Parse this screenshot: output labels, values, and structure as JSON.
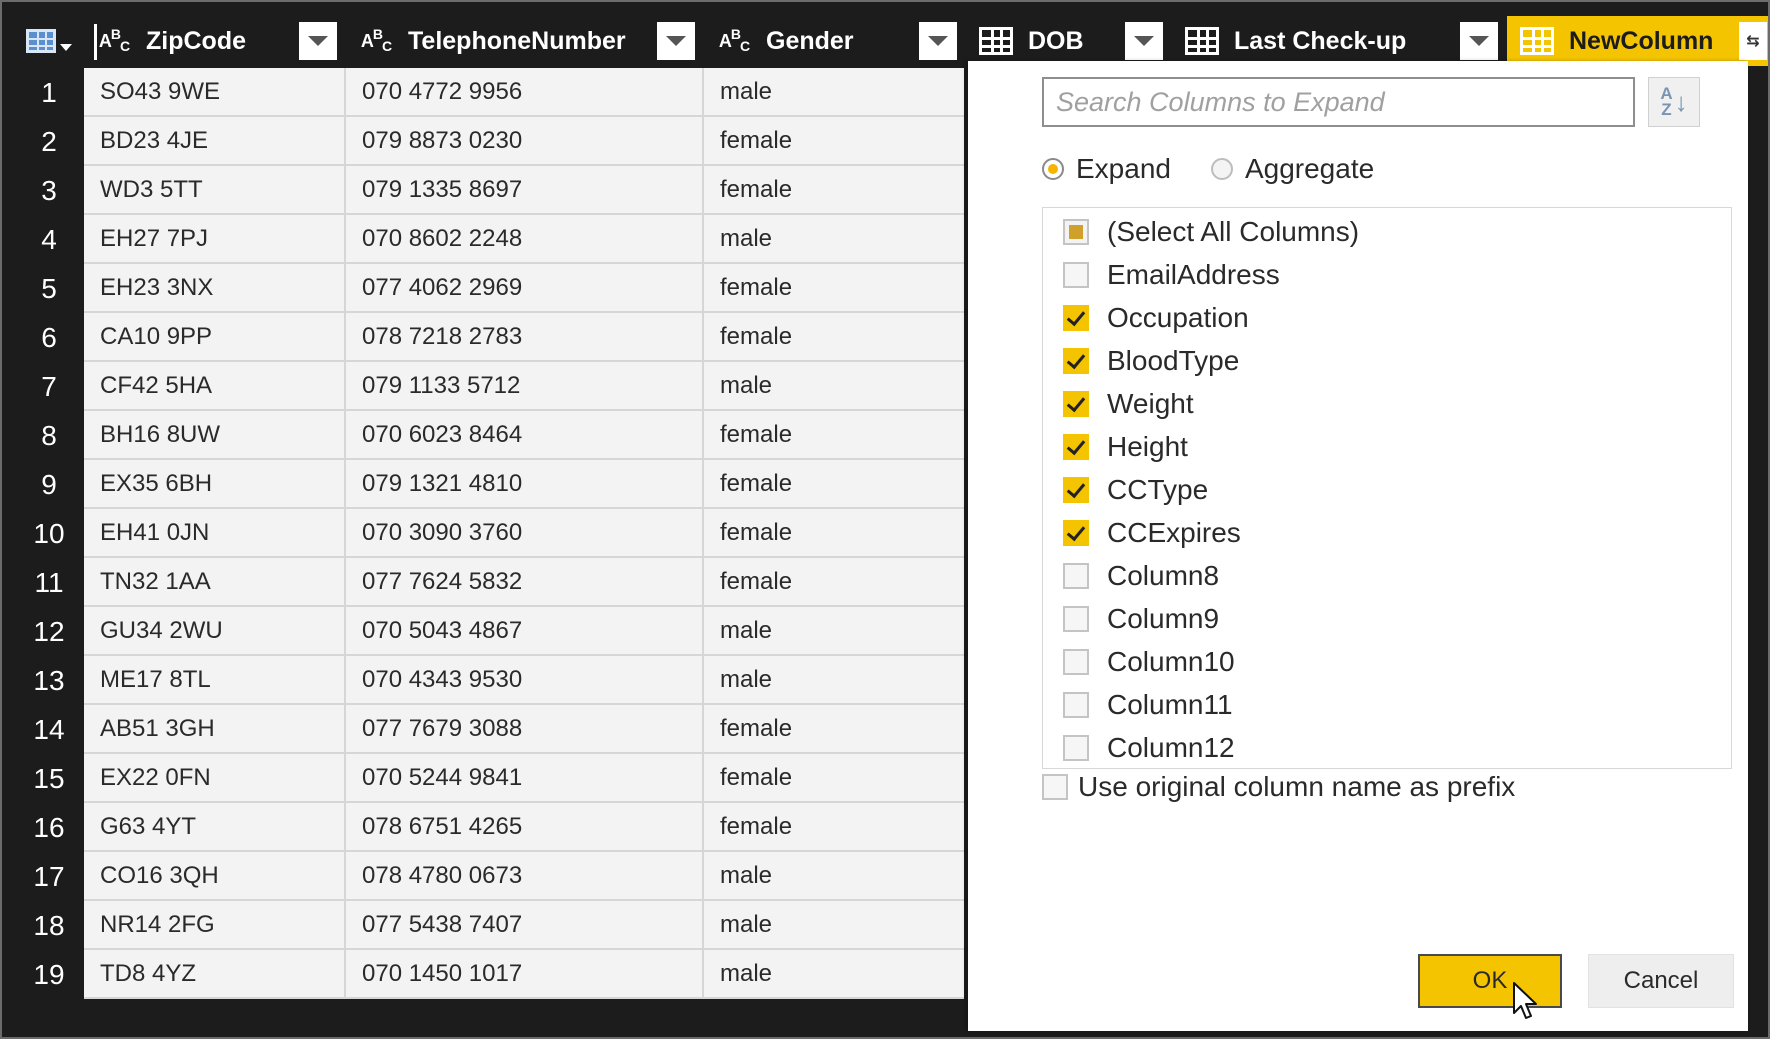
{
  "header": {
    "columns": [
      {
        "type": "ABC",
        "label": "ZipCode"
      },
      {
        "type": "ABC",
        "label": "TelephoneNumber"
      },
      {
        "type": "ABC",
        "label": "Gender"
      },
      {
        "type": "table",
        "label": "DOB"
      },
      {
        "type": "table",
        "label": "Last Check-up"
      },
      {
        "type": "table",
        "label": "NewColumn"
      }
    ],
    "expand_glyph": "⇆"
  },
  "rows": [
    {
      "n": "1",
      "zip": "SO43 9WE",
      "tel": "070 4772 9956",
      "gender": "male"
    },
    {
      "n": "2",
      "zip": "BD23 4JE",
      "tel": "079 8873 0230",
      "gender": "female"
    },
    {
      "n": "3",
      "zip": "WD3 5TT",
      "tel": "079 1335 8697",
      "gender": "female"
    },
    {
      "n": "4",
      "zip": "EH27 7PJ",
      "tel": "070 8602 2248",
      "gender": "male"
    },
    {
      "n": "5",
      "zip": "EH23 3NX",
      "tel": "077 4062 2969",
      "gender": "female"
    },
    {
      "n": "6",
      "zip": "CA10 9PP",
      "tel": "078 7218 2783",
      "gender": "female"
    },
    {
      "n": "7",
      "zip": "CF42 5HA",
      "tel": "079 1133 5712",
      "gender": "male"
    },
    {
      "n": "8",
      "zip": "BH16 8UW",
      "tel": "070 6023 8464",
      "gender": "female"
    },
    {
      "n": "9",
      "zip": "EX35 6BH",
      "tel": "079 1321 4810",
      "gender": "female"
    },
    {
      "n": "10",
      "zip": "EH41 0JN",
      "tel": "070 3090 3760",
      "gender": "female"
    },
    {
      "n": "11",
      "zip": "TN32 1AA",
      "tel": "077 7624 5832",
      "gender": "female"
    },
    {
      "n": "12",
      "zip": "GU34 2WU",
      "tel": "070 5043 4867",
      "gender": "male"
    },
    {
      "n": "13",
      "zip": "ME17 8TL",
      "tel": "070 4343 9530",
      "gender": "male"
    },
    {
      "n": "14",
      "zip": "AB51 3GH",
      "tel": "077 7679 3088",
      "gender": "female"
    },
    {
      "n": "15",
      "zip": "EX22 0FN",
      "tel": "070 5244 9841",
      "gender": "female"
    },
    {
      "n": "16",
      "zip": "G63 4YT",
      "tel": "078 6751 4265",
      "gender": "female"
    },
    {
      "n": "17",
      "zip": "CO16 3QH",
      "tel": "078 4780 0673",
      "gender": "male"
    },
    {
      "n": "18",
      "zip": "NR14 2FG",
      "tel": "077 5438 7407",
      "gender": "male"
    },
    {
      "n": "19",
      "zip": "TD8 4YZ",
      "tel": "070 1450 1017",
      "gender": "male"
    }
  ],
  "dialog": {
    "search_placeholder": "Search Columns to Expand",
    "sort_label_a": "A",
    "sort_label_z": "Z",
    "mode_expand": "Expand",
    "mode_aggregate": "Aggregate",
    "selected_mode": "Expand",
    "columns": [
      {
        "label": "(Select All Columns)",
        "state": "partial"
      },
      {
        "label": "EmailAddress",
        "state": "off"
      },
      {
        "label": "Occupation",
        "state": "on"
      },
      {
        "label": "BloodType",
        "state": "on"
      },
      {
        "label": "Weight",
        "state": "on"
      },
      {
        "label": "Height",
        "state": "on"
      },
      {
        "label": "CCType",
        "state": "on"
      },
      {
        "label": "CCExpires",
        "state": "on"
      },
      {
        "label": "Column8",
        "state": "off"
      },
      {
        "label": "Column9",
        "state": "off"
      },
      {
        "label": "Column10",
        "state": "off"
      },
      {
        "label": "Column11",
        "state": "off"
      },
      {
        "label": "Column12",
        "state": "off"
      }
    ],
    "prefix_label": "Use original column name as prefix",
    "prefix_checked": false,
    "ok_label": "OK",
    "cancel_label": "Cancel"
  },
  "colors": {
    "accent": "#f5c400",
    "header_bg": "#1c1c1c",
    "cell_bg": "#f3f3f3"
  }
}
